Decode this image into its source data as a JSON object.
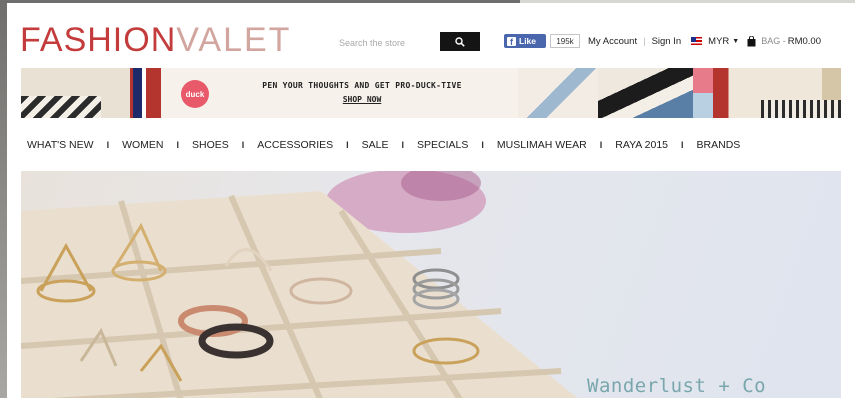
{
  "header": {
    "logo_part1": "FASHION",
    "logo_part2": "VALET",
    "search_placeholder": "Search the store",
    "fb_like_label": "Like",
    "fb_like_count": "195k",
    "my_account": "My Account",
    "sign_in": "Sign In",
    "currency": "MYR",
    "bag_label": "BAG -",
    "bag_amount": "RM0.00"
  },
  "promo": {
    "brand_badge": "duck",
    "headline": "PEN YOUR THOUGHTS AND GET PRO-DUCK-TIVE",
    "cta": "SHOP NOW"
  },
  "nav": {
    "items": [
      "WHAT'S NEW",
      "WOMEN",
      "SHOES",
      "ACCESSORIES",
      "SALE",
      "SPECIALS",
      "MUSLIMAH WEAR",
      "RAYA 2015",
      "BRANDS"
    ],
    "separator": "I"
  },
  "hero": {
    "caption": "Wanderlust + Co"
  },
  "colors": {
    "brand_red": "#c33b3b",
    "brand_pink": "#d2a59f",
    "fb_blue": "#4a67ad",
    "caption_teal": "#7aa7ad"
  },
  "icons": {
    "search": "search-icon",
    "bag": "shopping-bag-icon",
    "flag": "malaysia-flag-icon",
    "caret": "caret-down-icon"
  }
}
